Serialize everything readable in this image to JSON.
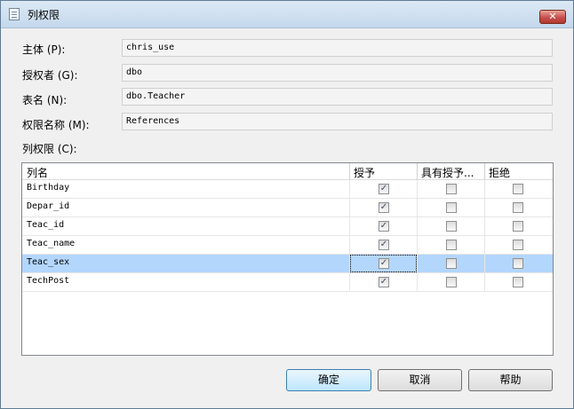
{
  "window": {
    "title": "列权限",
    "close_glyph": "✕"
  },
  "fields": [
    {
      "label": "主体 (P):",
      "value": "chris_use"
    },
    {
      "label": "授权者 (G):",
      "value": "dbo"
    },
    {
      "label": "表名 (N):",
      "value": "dbo.Teacher"
    },
    {
      "label": "权限名称 (M):",
      "value": "References"
    }
  ],
  "grid": {
    "label": "列权限 (C):",
    "headers": [
      "列名",
      "授予",
      "具有授予...",
      "拒绝"
    ],
    "rows": [
      {
        "name": "Birthday",
        "grant": true,
        "with_grant": false,
        "deny": false
      },
      {
        "name": "Depar_id",
        "grant": true,
        "with_grant": false,
        "deny": false
      },
      {
        "name": "Teac_id",
        "grant": true,
        "with_grant": false,
        "deny": false
      },
      {
        "name": "Teac_name",
        "grant": true,
        "with_grant": false,
        "deny": false
      },
      {
        "name": "Teac_sex",
        "grant": true,
        "with_grant": false,
        "deny": false,
        "selected": true
      },
      {
        "name": "TechPost",
        "grant": true,
        "with_grant": false,
        "deny": false
      }
    ]
  },
  "buttons": {
    "ok": "确定",
    "cancel": "取消",
    "help": "帮助"
  },
  "icons": {
    "window_icon": "document-icon",
    "close": "close-icon",
    "check_mark": "✓"
  },
  "colors": {
    "selection": "#b3d6fd",
    "close_button": "#c75050",
    "default_button_border": "#3c7fb1"
  }
}
